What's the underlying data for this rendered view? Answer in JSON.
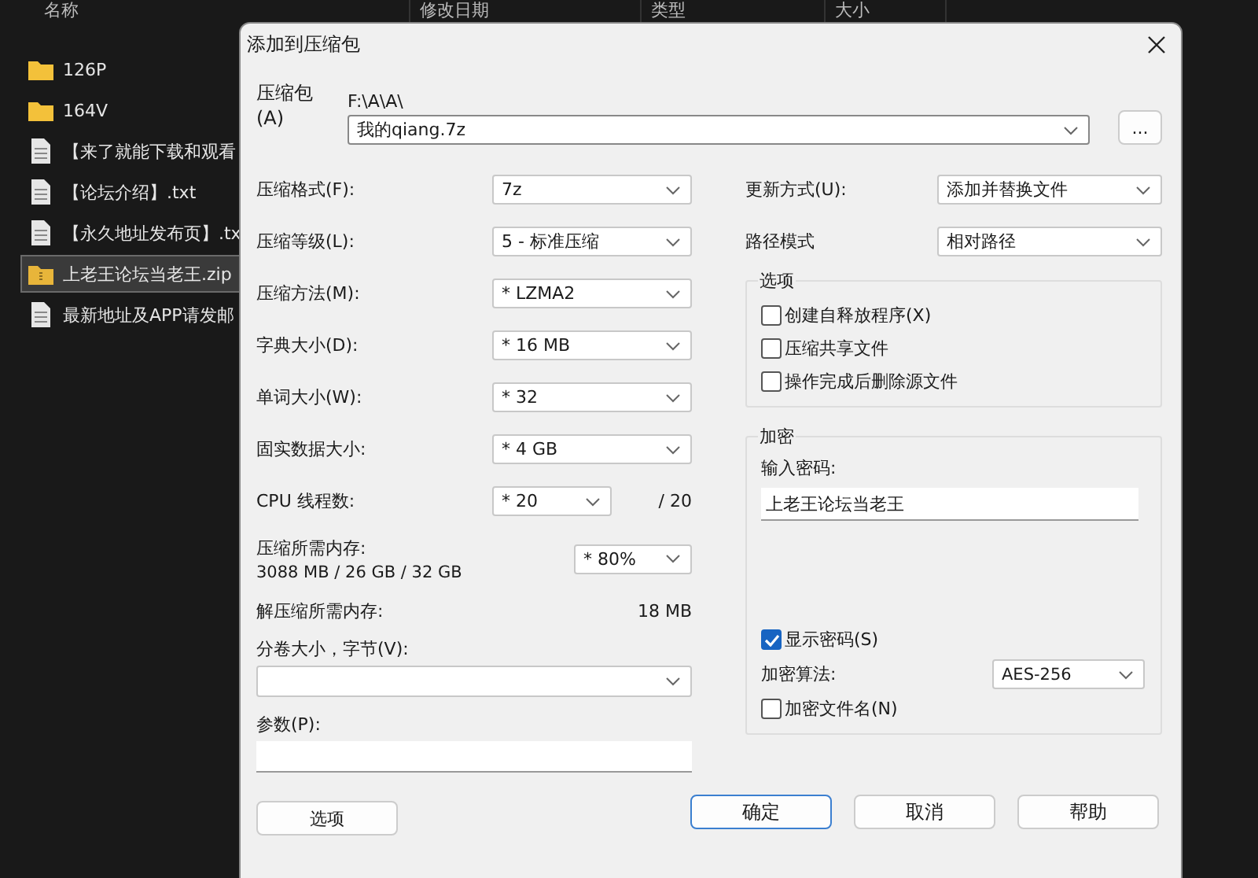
{
  "explorer": {
    "columns": [
      "名称",
      "修改日期",
      "类型",
      "大小"
    ],
    "files": [
      {
        "name": "126P",
        "kind": "folder",
        "selected": false
      },
      {
        "name": "164V",
        "kind": "folder",
        "selected": false
      },
      {
        "name": "【来了就能下载和观看",
        "kind": "text",
        "selected": false
      },
      {
        "name": "【论坛介绍】.txt",
        "kind": "text",
        "selected": false
      },
      {
        "name": "【永久地址发布页】.tx",
        "kind": "text",
        "selected": false
      },
      {
        "name": "上老王论坛当老王.zip",
        "kind": "zip",
        "selected": true
      },
      {
        "name": "最新地址及APP请发邮",
        "kind": "text",
        "selected": false
      }
    ]
  },
  "dialog": {
    "title": "添加到压缩包",
    "archive": {
      "label": "压缩包(A)",
      "path": "F:\\A\\A\\",
      "value": "我的qiang.7z",
      "browse": "..."
    },
    "left": [
      {
        "kind": "select",
        "label": "压缩格式(F):",
        "value": "7z"
      },
      {
        "kind": "select",
        "label": "压缩等级(L):",
        "value": "5 - 标准压缩"
      },
      {
        "kind": "select",
        "label": "压缩方法(M):",
        "value": "* LZMA2"
      },
      {
        "kind": "select",
        "label": "字典大小(D):",
        "value": "* 16 MB"
      },
      {
        "kind": "select",
        "label": "单词大小(W):",
        "value": "* 32"
      },
      {
        "kind": "select",
        "label": "固实数据大小:",
        "value": "* 4 GB"
      },
      {
        "kind": "select_suffix",
        "label": "CPU 线程数:",
        "value": "* 20",
        "suffix": "/ 20"
      },
      {
        "kind": "memory",
        "label": "压缩所需内存:",
        "detail": "3088 MB / 26 GB / 32 GB",
        "value": "* 80%"
      },
      {
        "kind": "value",
        "label": "解压缩所需内存:",
        "value": "18 MB"
      },
      {
        "kind": "select_block",
        "label": "分卷大小，字节(V):"
      },
      {
        "kind": "input_block",
        "label": "参数(P):"
      }
    ],
    "options_button": "选项",
    "right": [
      {
        "label": "更新方式(U):",
        "value": "添加并替换文件"
      },
      {
        "label": "路径模式",
        "value": "相对路径"
      }
    ],
    "options": {
      "title": "选项",
      "checkboxes": [
        {
          "label": "创建自释放程序(X)",
          "checked": false
        },
        {
          "label": "压缩共享文件",
          "checked": false
        },
        {
          "label": "操作完成后删除源文件",
          "checked": false
        }
      ]
    },
    "encryption": {
      "title": "加密",
      "password_label": "输入密码:",
      "password": "上老王论坛当老王",
      "show_password": {
        "label": "显示密码(S)",
        "checked": true
      },
      "method_label": "加密算法:",
      "method": "AES-256",
      "encrypt_names": {
        "label": "加密文件名(N)",
        "checked": false
      }
    },
    "buttons": [
      {
        "label": "确定",
        "focused": true
      },
      {
        "label": "取消",
        "focused": false
      },
      {
        "label": "帮助",
        "focused": false
      }
    ]
  }
}
